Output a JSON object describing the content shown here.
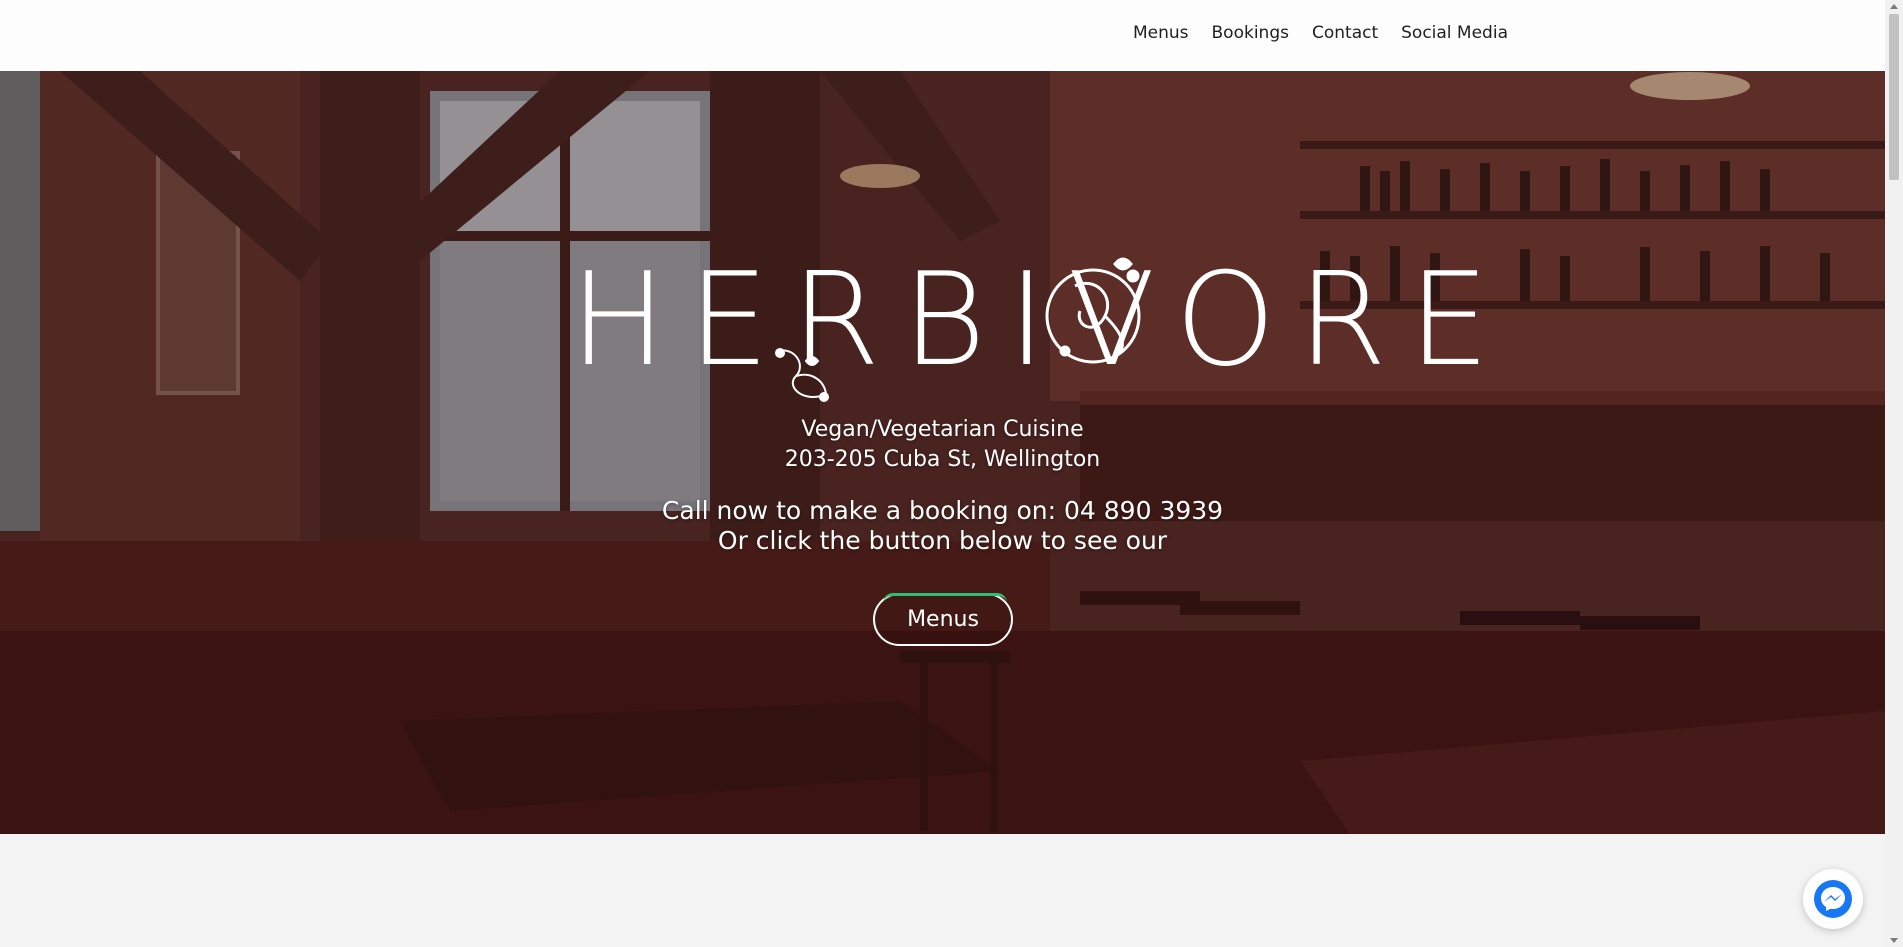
{
  "nav": {
    "items": [
      {
        "label": "Menus"
      },
      {
        "label": "Bookings"
      },
      {
        "label": "Contact"
      },
      {
        "label": "Social Media"
      }
    ]
  },
  "hero": {
    "logo_text": "HERBIVORE",
    "tagline_line1": "Vegan/Vegetarian Cuisine",
    "tagline_line2": "203-205 Cuba St, Wellington",
    "call_line1": "Call now to make a booking on: 04 890 3939",
    "call_line2": "Or click the button below to see our",
    "button_label": "Menus"
  },
  "colors": {
    "accent": "#2fbf71",
    "messenger": "#1877f2"
  },
  "icons": {
    "messenger": "messenger-icon",
    "flourish": "flourish-ornament"
  }
}
